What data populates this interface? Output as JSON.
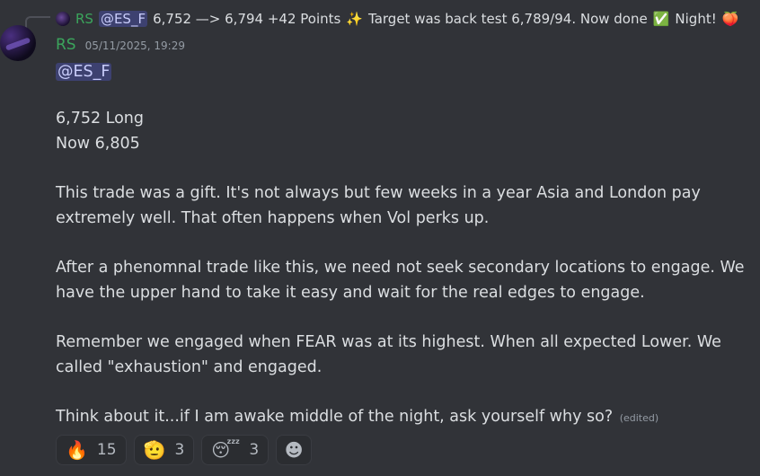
{
  "reply": {
    "author": "RS",
    "mention": "@ES_F",
    "text": "6,752 —> 6,794  +42 Points",
    "text2": "Target was back test 6,789/94. Now done",
    "text3": "Night!",
    "emoji_sparkles": "✨",
    "emoji_check": "✅",
    "emoji_peach": "🍑"
  },
  "message": {
    "author": "RS",
    "timestamp": "05/11/2025, 19:29",
    "mention": "@ES_F",
    "lines": [
      "6,752 Long",
      "Now 6,805"
    ],
    "paragraphs": [
      "This trade was a gift. It's not always but few weeks in a year Asia and London pay extremely well. That often happens when Vol perks up.",
      "After a phenomnal trade like this, we need not seek secondary locations to engage. We have the upper hand to take it easy and wait for the real edges to engage.",
      "Remember we engaged when FEAR was at its highest. When all expected Lower. We called \"exhaustion\" and engaged.",
      "Think about it...if I am awake middle of the night, ask yourself why so?"
    ],
    "edited_label": "(edited)",
    "author_color": "#3ba55c"
  },
  "reactions": [
    {
      "emoji": "🔥",
      "count": "15",
      "icon": "fire-icon"
    },
    {
      "emoji": "🫡",
      "count": "3",
      "icon": "salute-icon"
    },
    {
      "emoji": "😴",
      "count": "3",
      "icon": "sleeping-face-icon"
    },
    {
      "emoji": "☻",
      "icon": "add-reaction-icon"
    }
  ]
}
